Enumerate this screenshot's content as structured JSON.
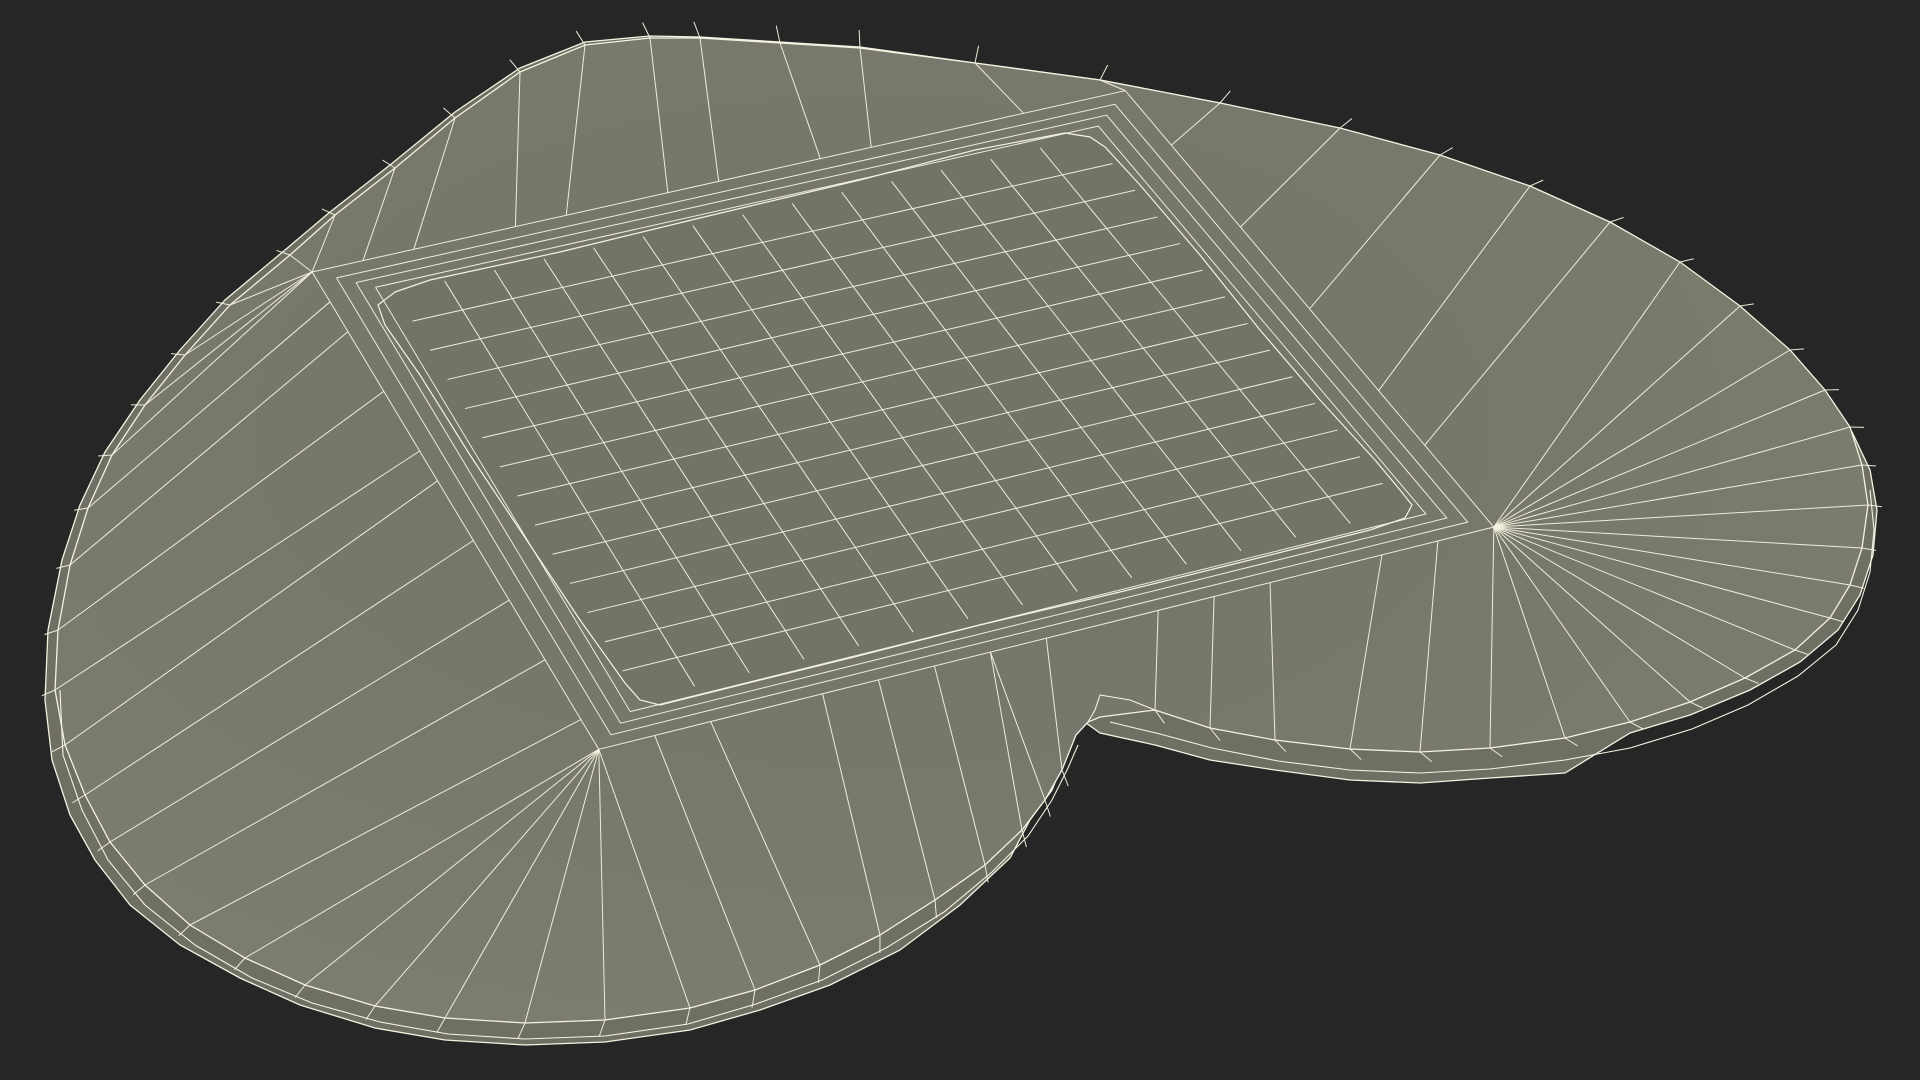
{
  "scene": {
    "background_color": "#262626",
    "mesh_fill_color": "#7a7b6d",
    "mesh_fill_inner_color": "#737468",
    "wire_color": "#f4f3e2",
    "object": "heart-shaped-tray-wireframe"
  }
}
